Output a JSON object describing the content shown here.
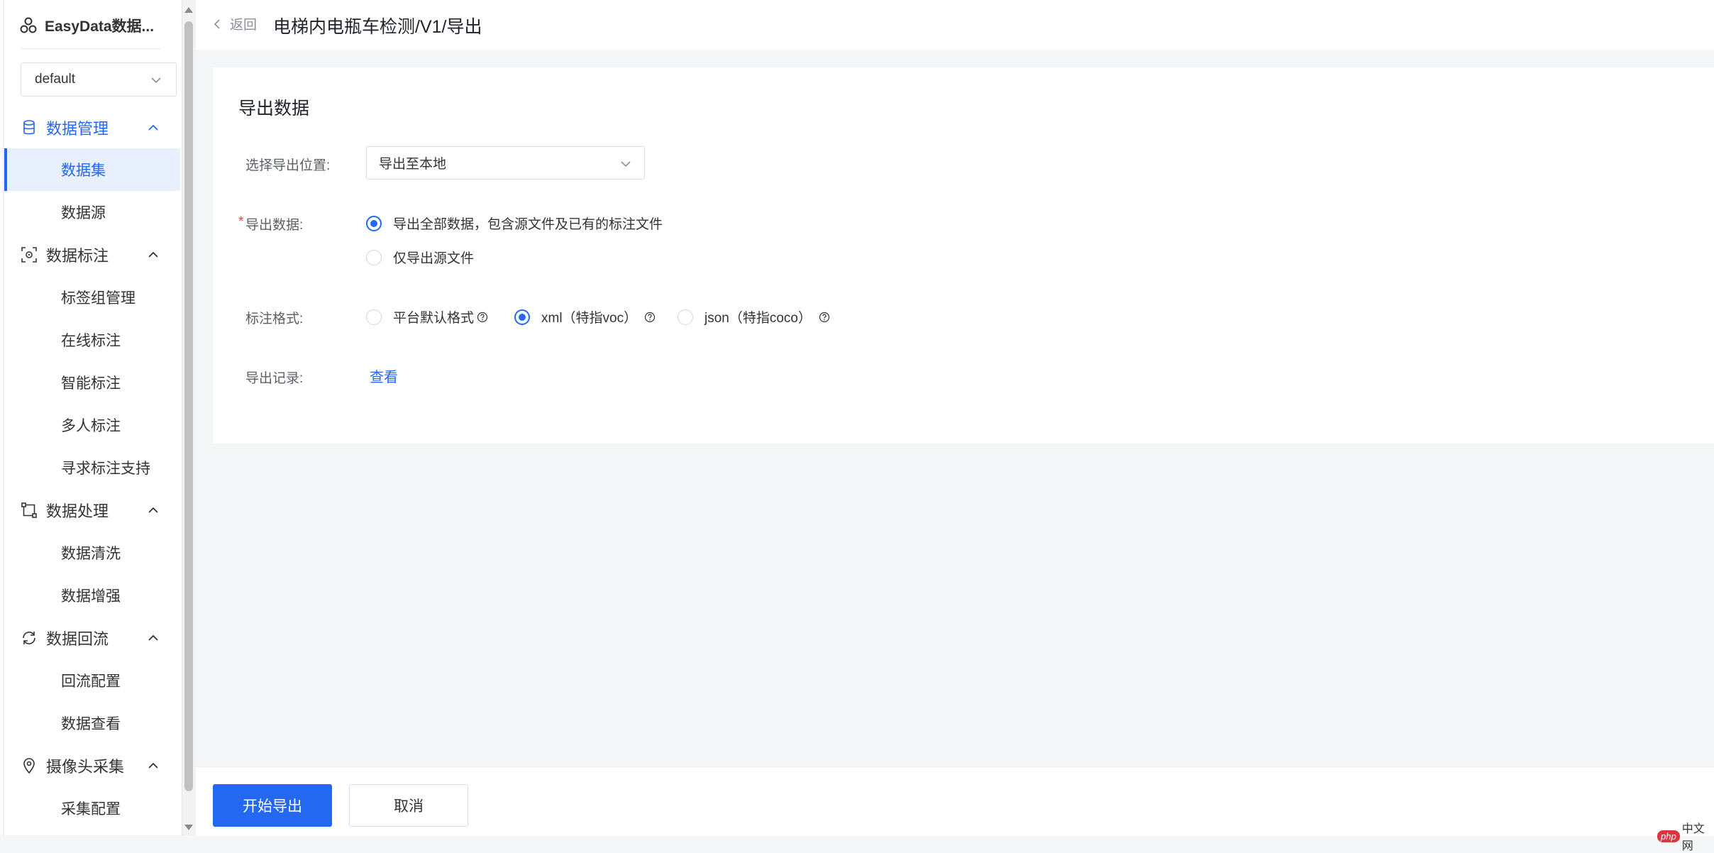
{
  "app": {
    "name": "EasyData数据..."
  },
  "workspace": {
    "selected": "default"
  },
  "sidebar": {
    "groups": [
      {
        "label": "数据管理",
        "items": [
          "数据集",
          "数据源"
        ]
      },
      {
        "label": "数据标注",
        "items": [
          "标签组管理",
          "在线标注",
          "智能标注",
          "多人标注",
          "寻求标注支持"
        ]
      },
      {
        "label": "数据处理",
        "items": [
          "数据清洗",
          "数据增强"
        ]
      },
      {
        "label": "数据回流",
        "items": [
          "回流配置",
          "数据查看"
        ]
      },
      {
        "label": "摄像头采集",
        "items": [
          "采集配置"
        ]
      }
    ],
    "active_item": "数据集"
  },
  "header": {
    "back_label": "返回",
    "title": "电梯内电瓶车检测/V1/导出"
  },
  "form": {
    "title": "导出数据",
    "destination": {
      "label": "选择导出位置:",
      "value": "导出至本地"
    },
    "data_scope": {
      "label": "导出数据:",
      "options": [
        "导出全部数据，包含源文件及已有的标注文件",
        "仅导出源文件"
      ],
      "selected": 0
    },
    "annotation_format": {
      "label": "标注格式:",
      "options": [
        "平台默认格式",
        "xml（特指voc）",
        "json（特指coco）"
      ],
      "selected": 1
    },
    "export_record": {
      "label": "导出记录:",
      "link": "查看"
    }
  },
  "footer": {
    "primary_label": "开始导出",
    "cancel_label": "取消"
  },
  "watermark": {
    "badge": "php",
    "text": "中文网"
  },
  "colors": {
    "accent": "#2468f2",
    "required": "#f03e3e",
    "background": "#f5f6f8"
  }
}
